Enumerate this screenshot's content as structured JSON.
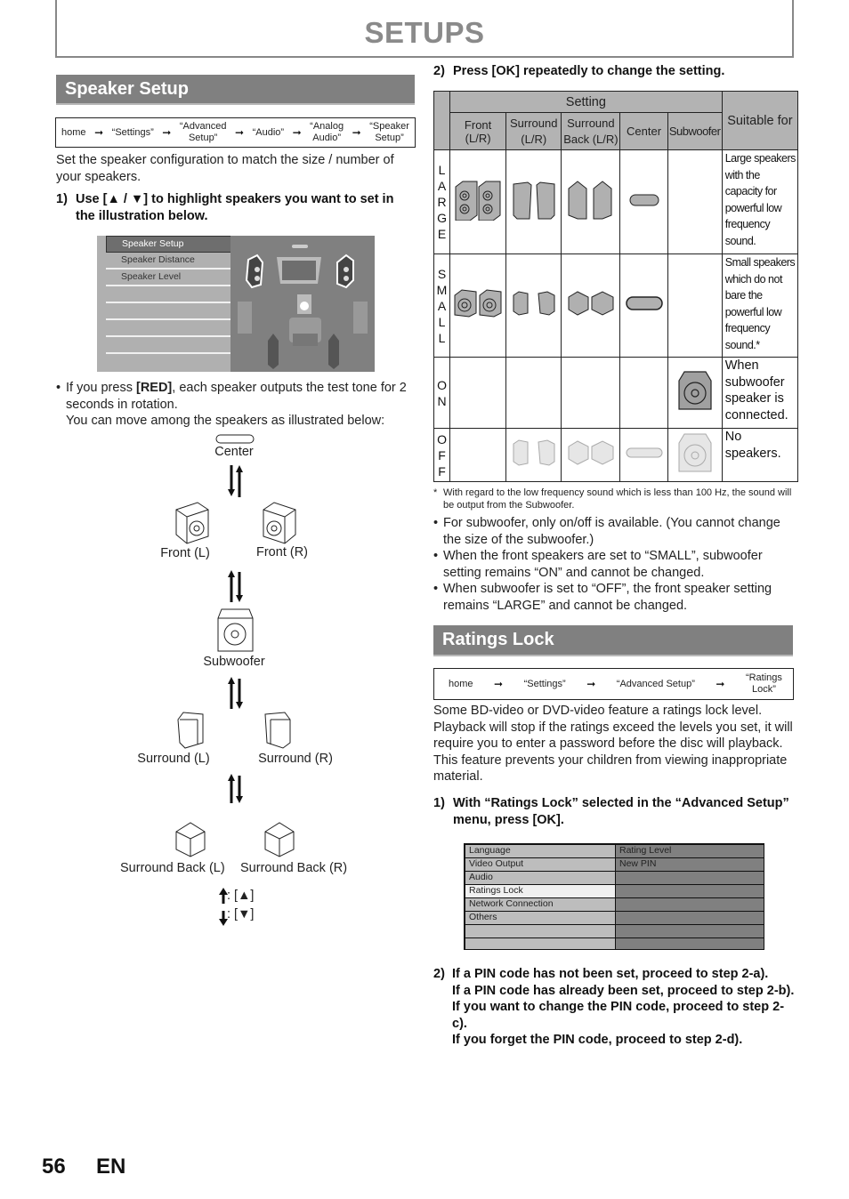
{
  "page_title": "SETUPS",
  "speaker_setup": {
    "heading": "Speaker Setup",
    "breadcrumb": [
      "home",
      "“Settings”",
      "“Advanced\nSetup”",
      "“Audio”",
      "“Analog\nAudio”",
      "“Speaker\nSetup”"
    ],
    "breadcrumb_arrow": "➞",
    "intro": "Set the speaker configuration to match the size / number of your speakers.",
    "step1_num": "1)",
    "step1_pre": "Use [",
    "step1_up": "▲",
    "step1_mid": " / ",
    "step1_down": "▼",
    "step1_post": "] to highlight speakers you want to set in the illustration below.",
    "menu_items": [
      "Speaker Setup",
      "Speaker Distance",
      "Speaker Level"
    ],
    "bullet_pre": "If you press ",
    "bullet_bold": "[RED]",
    "bullet_post": ", each speaker outputs the test tone for 2 seconds in rotation.",
    "bullet_line2": "You can move among the speakers as illustrated below:",
    "rotation_labels": {
      "center": "Center",
      "front_l": "Front (L)",
      "front_r": "Front (R)",
      "subwoofer": "Subwoofer",
      "surround_l": "Surround (L)",
      "surround_r": "Surround (R)",
      "surround_back_l": "Surround Back (L)",
      "surround_back_r": "Surround Back (R)"
    },
    "legend_up": ": [▲]",
    "legend_down": ": [▼]"
  },
  "step2": {
    "num": "2)",
    "text": "Press [OK] repeatedly to change the setting."
  },
  "settings_table": {
    "group_header": "Setting",
    "suitable_header": "Suitable for",
    "columns": [
      "Front (L/R)",
      "Surround\n(L/R)",
      "Surround\nBack (L/R)",
      "Center",
      "Subwoofer"
    ],
    "rows": [
      {
        "label": "LARGE",
        "desc": "Large speakers with the capacity for powerful low frequency sound."
      },
      {
        "label": "SMALL",
        "desc": "Small speakers which do not bare the powerful low frequency sound.*"
      },
      {
        "label": "ON",
        "desc": "When subwoofer speaker is connected."
      },
      {
        "label": "OFF",
        "desc": "No speakers."
      }
    ]
  },
  "footnote": "With regard to the low frequency sound which is less than 100 Hz, the sound will be output from the Subwoofer.",
  "footnote_mark": "*",
  "notes": [
    "For subwoofer, only on/off is available. (You cannot change the size of the subwoofer.)",
    "When the front speakers are set to “SMALL”, subwoofer setting remains “ON” and cannot be changed.",
    "When subwoofer is set to “OFF”, the front speaker setting remains “LARGE” and cannot be changed."
  ],
  "ratings_lock": {
    "heading": "Ratings Lock",
    "breadcrumb": [
      "home",
      "“Settings”",
      "“Advanced Setup”",
      "“Ratings\nLock”"
    ],
    "intro": "Some BD-video or DVD-video feature a ratings lock level. Playback will stop if the ratings exceed the levels you set, it will require you to enter a password before the disc will playback. This feature prevents your children from viewing inappropriate material.",
    "step1_num": "1)",
    "step1": "With “Ratings Lock” selected in the “Advanced Setup” menu, press [OK].",
    "menu_left": [
      "Language",
      "Video Output",
      "Audio",
      "Ratings Lock",
      "Network Connection",
      "Others",
      "",
      ""
    ],
    "menu_right": [
      "Rating Level",
      "New PIN",
      "",
      "",
      "",
      "",
      "",
      ""
    ],
    "menu_selected": "Ratings Lock",
    "step2_num": "2)",
    "step2_lines": [
      "If a PIN code has not been set, proceed to step 2-a).",
      "If a PIN code has already been set, proceed to step 2-b).",
      "If you want to change the PIN code, proceed to step 2-c).",
      "If you forget the PIN code, proceed to step 2-d)."
    ]
  },
  "footer": {
    "page_number": "56",
    "language": "EN"
  }
}
